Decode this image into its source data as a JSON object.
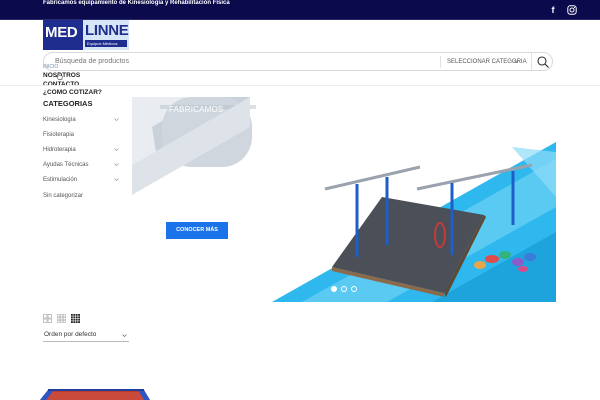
{
  "topbar": {
    "text": "Fabricamos equipamiento de Kinesiología y Rehabilitación Física",
    "social_icons": [
      "facebook-icon",
      "instagram-icon"
    ]
  },
  "logo": {
    "part1": "MED",
    "part2": "LINNE",
    "tagline": "Equipos Médicos"
  },
  "search": {
    "placeholder": "Búsqueda de productos",
    "category_label": "SELECCIONAR CATEGORIA"
  },
  "nav": {
    "inicio": "INICIO",
    "items": [
      "NOSOTROS",
      "CONTACTO",
      "¿COMO COTIZAR?"
    ]
  },
  "categories": {
    "title": "CATEGORIAS",
    "items": [
      {
        "label": "Kinesiología",
        "expandable": true
      },
      {
        "label": "Fisioterapia",
        "expandable": false
      },
      {
        "label": "Hidroterapia",
        "expandable": true
      },
      {
        "label": "Ayudas Técnicas",
        "expandable": true
      },
      {
        "label": "Estimulación",
        "expandable": true
      },
      {
        "label": "Sin categorizar",
        "expandable": false
      }
    ]
  },
  "hero": {
    "label": "FABRICAMOS",
    "button": "CONOCER MÁS",
    "slide_count": 3,
    "active_slide": 1
  },
  "shop": {
    "view_options": [
      "2-columns",
      "3-columns",
      "4-columns"
    ],
    "active_view": "4-columns",
    "sort_label": "Orden por defecto"
  },
  "colors": {
    "topbar": "#0a0a4d",
    "brand_blue": "#1f2e8e",
    "accent": "#1a73e8",
    "hero_cyan": "#2fb8ee"
  }
}
